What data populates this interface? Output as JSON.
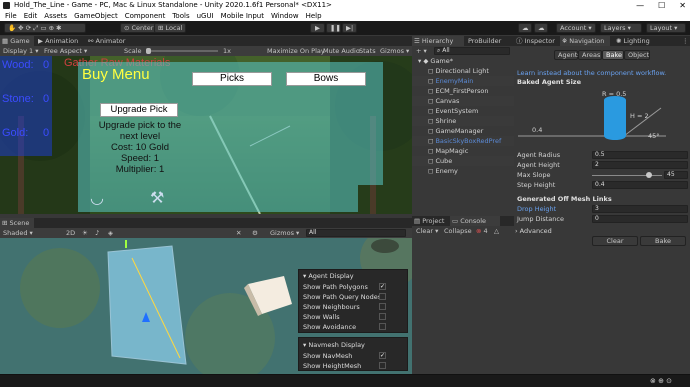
{
  "window": {
    "title": "Hold_The_Line - Game - PC, Mac & Linux Standalone - Unity 2020.1.6f1 Personal* <DX11>"
  },
  "menu": [
    "File",
    "Edit",
    "Assets",
    "GameObject",
    "Component",
    "Tools",
    "uGUI",
    "Mobile Input",
    "Window",
    "Help"
  ],
  "toolbar": {
    "center": "Center",
    "local": "Local",
    "account": "Account",
    "layers": "Layers",
    "layout": "Layout"
  },
  "game_view": {
    "tabs": [
      "Game",
      "Animation",
      "Animator"
    ],
    "display": "Display 1",
    "aspect": "Free Aspect",
    "scale_label": "Scale",
    "scale_value": "1x",
    "options": [
      "Maximize On Play",
      "Mute Audio",
      "Stats",
      "Gizmos"
    ]
  },
  "hud": {
    "wood_label": "Wood:",
    "wood_value": "0",
    "stone_label": "Stone:",
    "stone_value": "0",
    "gold_label": "Gold:",
    "gold_value": "0",
    "bg_text": "Gather Raw Materials"
  },
  "buy_menu": {
    "title": "Buy Menu",
    "picks_btn": "Picks",
    "bows_btn": "Bows",
    "upgrade_btn": "Upgrade Pick",
    "desc": [
      "Upgrade pick to the",
      "next level",
      "Cost: 10 Gold",
      "Speed: 1",
      "Multiplier: 1"
    ]
  },
  "hierarchy": {
    "tabs": [
      "Hierarchy",
      "ProBuilder"
    ],
    "search": "All",
    "scene": "Game*",
    "items": [
      {
        "name": "Directional Light",
        "color": "#d2d2d2"
      },
      {
        "name": "EnemyMain",
        "color": "#5b8ad6"
      },
      {
        "name": "ECM_FirstPerson",
        "color": "#d2d2d2"
      },
      {
        "name": "Canvas",
        "color": "#d2d2d2"
      },
      {
        "name": "EventSystem",
        "color": "#d2d2d2"
      },
      {
        "name": "Shrine",
        "color": "#d2d2d2"
      },
      {
        "name": "GameManager",
        "color": "#d2d2d2"
      },
      {
        "name": "BasicSkyBoxRedPref",
        "color": "#5b8ad6"
      },
      {
        "name": "MapMagic",
        "color": "#d2d2d2"
      },
      {
        "name": "Cube",
        "color": "#d2d2d2"
      },
      {
        "name": "Enemy",
        "color": "#d2d2d2"
      }
    ]
  },
  "project": {
    "tabs": [
      "Project",
      "Console"
    ],
    "clear": "Clear",
    "collapse": "Collapse",
    "count": "4"
  },
  "scene_view": {
    "tab": "Scene",
    "shading": "Shaded",
    "mode": "2D",
    "gizmos": "Gizmos",
    "search": "All"
  },
  "agent_display": {
    "title": "Agent Display",
    "items": [
      {
        "label": "Show Path Polygons",
        "checked": true
      },
      {
        "label": "Show Path Query Nodes",
        "checked": false
      },
      {
        "label": "Show Neighbours",
        "checked": false
      },
      {
        "label": "Show Walls",
        "checked": false
      },
      {
        "label": "Show Avoidance",
        "checked": false
      }
    ]
  },
  "navmesh_display": {
    "title": "Navmesh Display",
    "items": [
      {
        "label": "Show NavMesh",
        "checked": true
      },
      {
        "label": "Show HeightMesh",
        "checked": false
      }
    ]
  },
  "inspector": {
    "tabs": [
      "Inspector",
      "Navigation",
      "Lighting"
    ],
    "subtabs": [
      "Agents",
      "Areas",
      "Bake",
      "Object"
    ],
    "link": "Learn instead about the component workflow.",
    "baked_agent_size": "Baked Agent Size",
    "diagram": {
      "r": "R = 0.5",
      "h": "H = 2",
      "step": "0.4",
      "angle": "45°"
    },
    "fields": [
      {
        "label": "Agent Radius",
        "value": "0.5"
      },
      {
        "label": "Agent Height",
        "value": "2"
      },
      {
        "label": "Max Slope",
        "value": "45"
      },
      {
        "label": "Step Height",
        "value": "0.4"
      }
    ],
    "offmesh_title": "Generated Off Mesh Links",
    "offmesh": [
      {
        "label": "Drop Height",
        "value": "3"
      },
      {
        "label": "Jump Distance",
        "value": "0"
      }
    ],
    "advanced": "Advanced",
    "clear_btn": "Clear",
    "bake_btn": "Bake"
  }
}
